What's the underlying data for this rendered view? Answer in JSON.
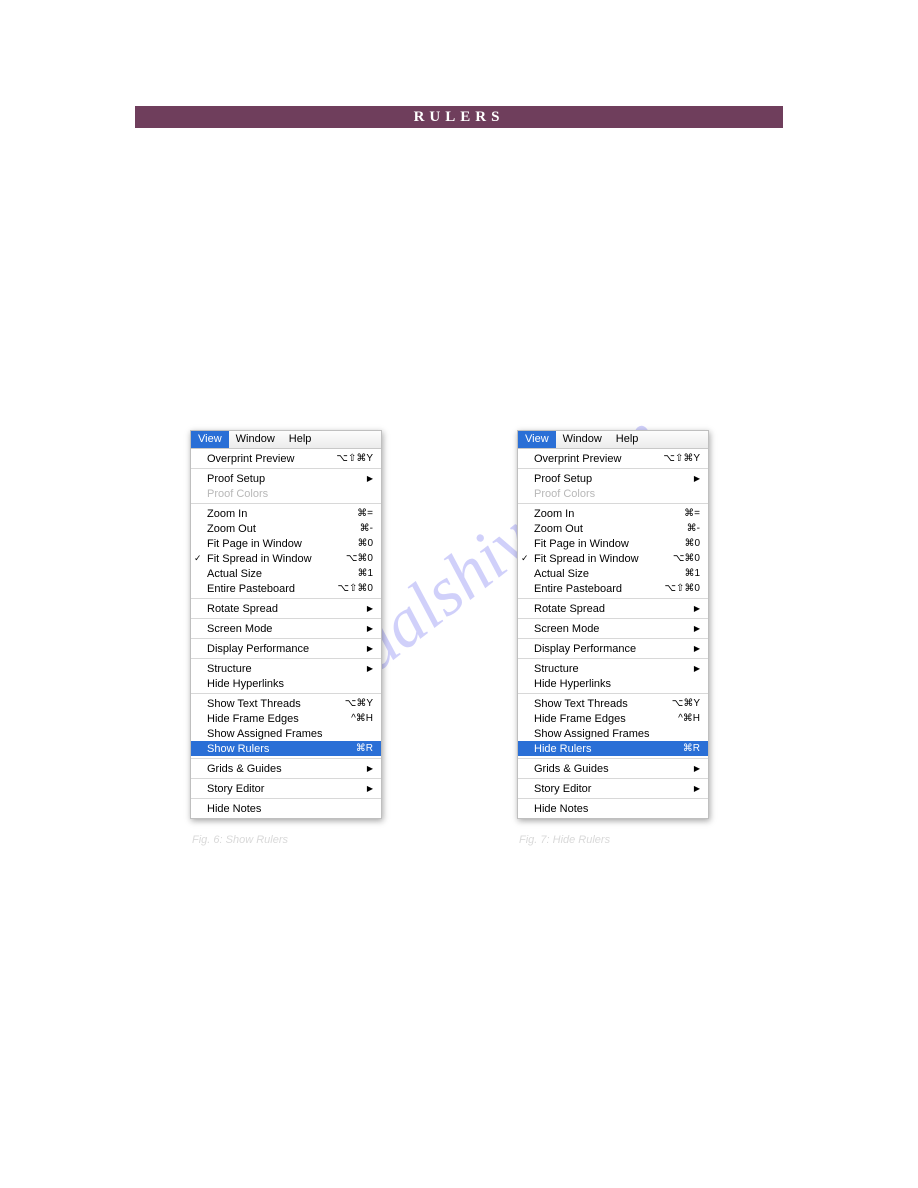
{
  "header": {
    "title": "RULERS"
  },
  "watermark": "manualshive.com",
  "menubar": {
    "items": [
      {
        "label": "View",
        "active": true
      },
      {
        "label": "Window",
        "active": false
      },
      {
        "label": "Help",
        "active": false
      }
    ]
  },
  "menu_groups": [
    {
      "items": [
        {
          "label": "Overprint Preview",
          "shortcut": "⌥⇧⌘Y"
        }
      ]
    },
    {
      "items": [
        {
          "label": "Proof Setup",
          "submenu": true
        },
        {
          "label": "Proof Colors",
          "disabled": true
        }
      ]
    },
    {
      "items": [
        {
          "label": "Zoom In",
          "shortcut": "⌘="
        },
        {
          "label": "Zoom Out",
          "shortcut": "⌘-"
        },
        {
          "label": "Fit Page in Window",
          "shortcut": "⌘0"
        },
        {
          "label": "Fit Spread in Window",
          "shortcut": "⌥⌘0",
          "checked": true
        },
        {
          "label": "Actual Size",
          "shortcut": "⌘1"
        },
        {
          "label": "Entire Pasteboard",
          "shortcut": "⌥⇧⌘0"
        }
      ]
    },
    {
      "items": [
        {
          "label": "Rotate Spread",
          "submenu": true
        }
      ]
    },
    {
      "items": [
        {
          "label": "Screen Mode",
          "submenu": true
        }
      ]
    },
    {
      "items": [
        {
          "label": "Display Performance",
          "submenu": true
        }
      ]
    },
    {
      "items": [
        {
          "label": "Structure",
          "submenu": true
        },
        {
          "label": "Hide Hyperlinks"
        }
      ]
    },
    {
      "items": [
        {
          "label": "Show Text Threads",
          "shortcut": "⌥⌘Y"
        },
        {
          "label": "Hide Frame Edges",
          "shortcut": "^⌘H"
        },
        {
          "label": "Show Assigned Frames"
        },
        {
          "slot": "rulers"
        }
      ]
    },
    {
      "items": [
        {
          "label": "Grids & Guides",
          "submenu": true
        }
      ]
    },
    {
      "items": [
        {
          "label": "Story Editor",
          "submenu": true
        }
      ]
    },
    {
      "items": [
        {
          "label": "Hide Notes"
        }
      ]
    }
  ],
  "panels": [
    {
      "rulers_item": {
        "label": "Show Rulers",
        "shortcut": "⌘R"
      },
      "caption": "Fig. 6: Show Rulers"
    },
    {
      "rulers_item": {
        "label": "Hide Rulers",
        "shortcut": "⌘R"
      },
      "caption": "Fig. 7: Hide Rulers"
    }
  ]
}
